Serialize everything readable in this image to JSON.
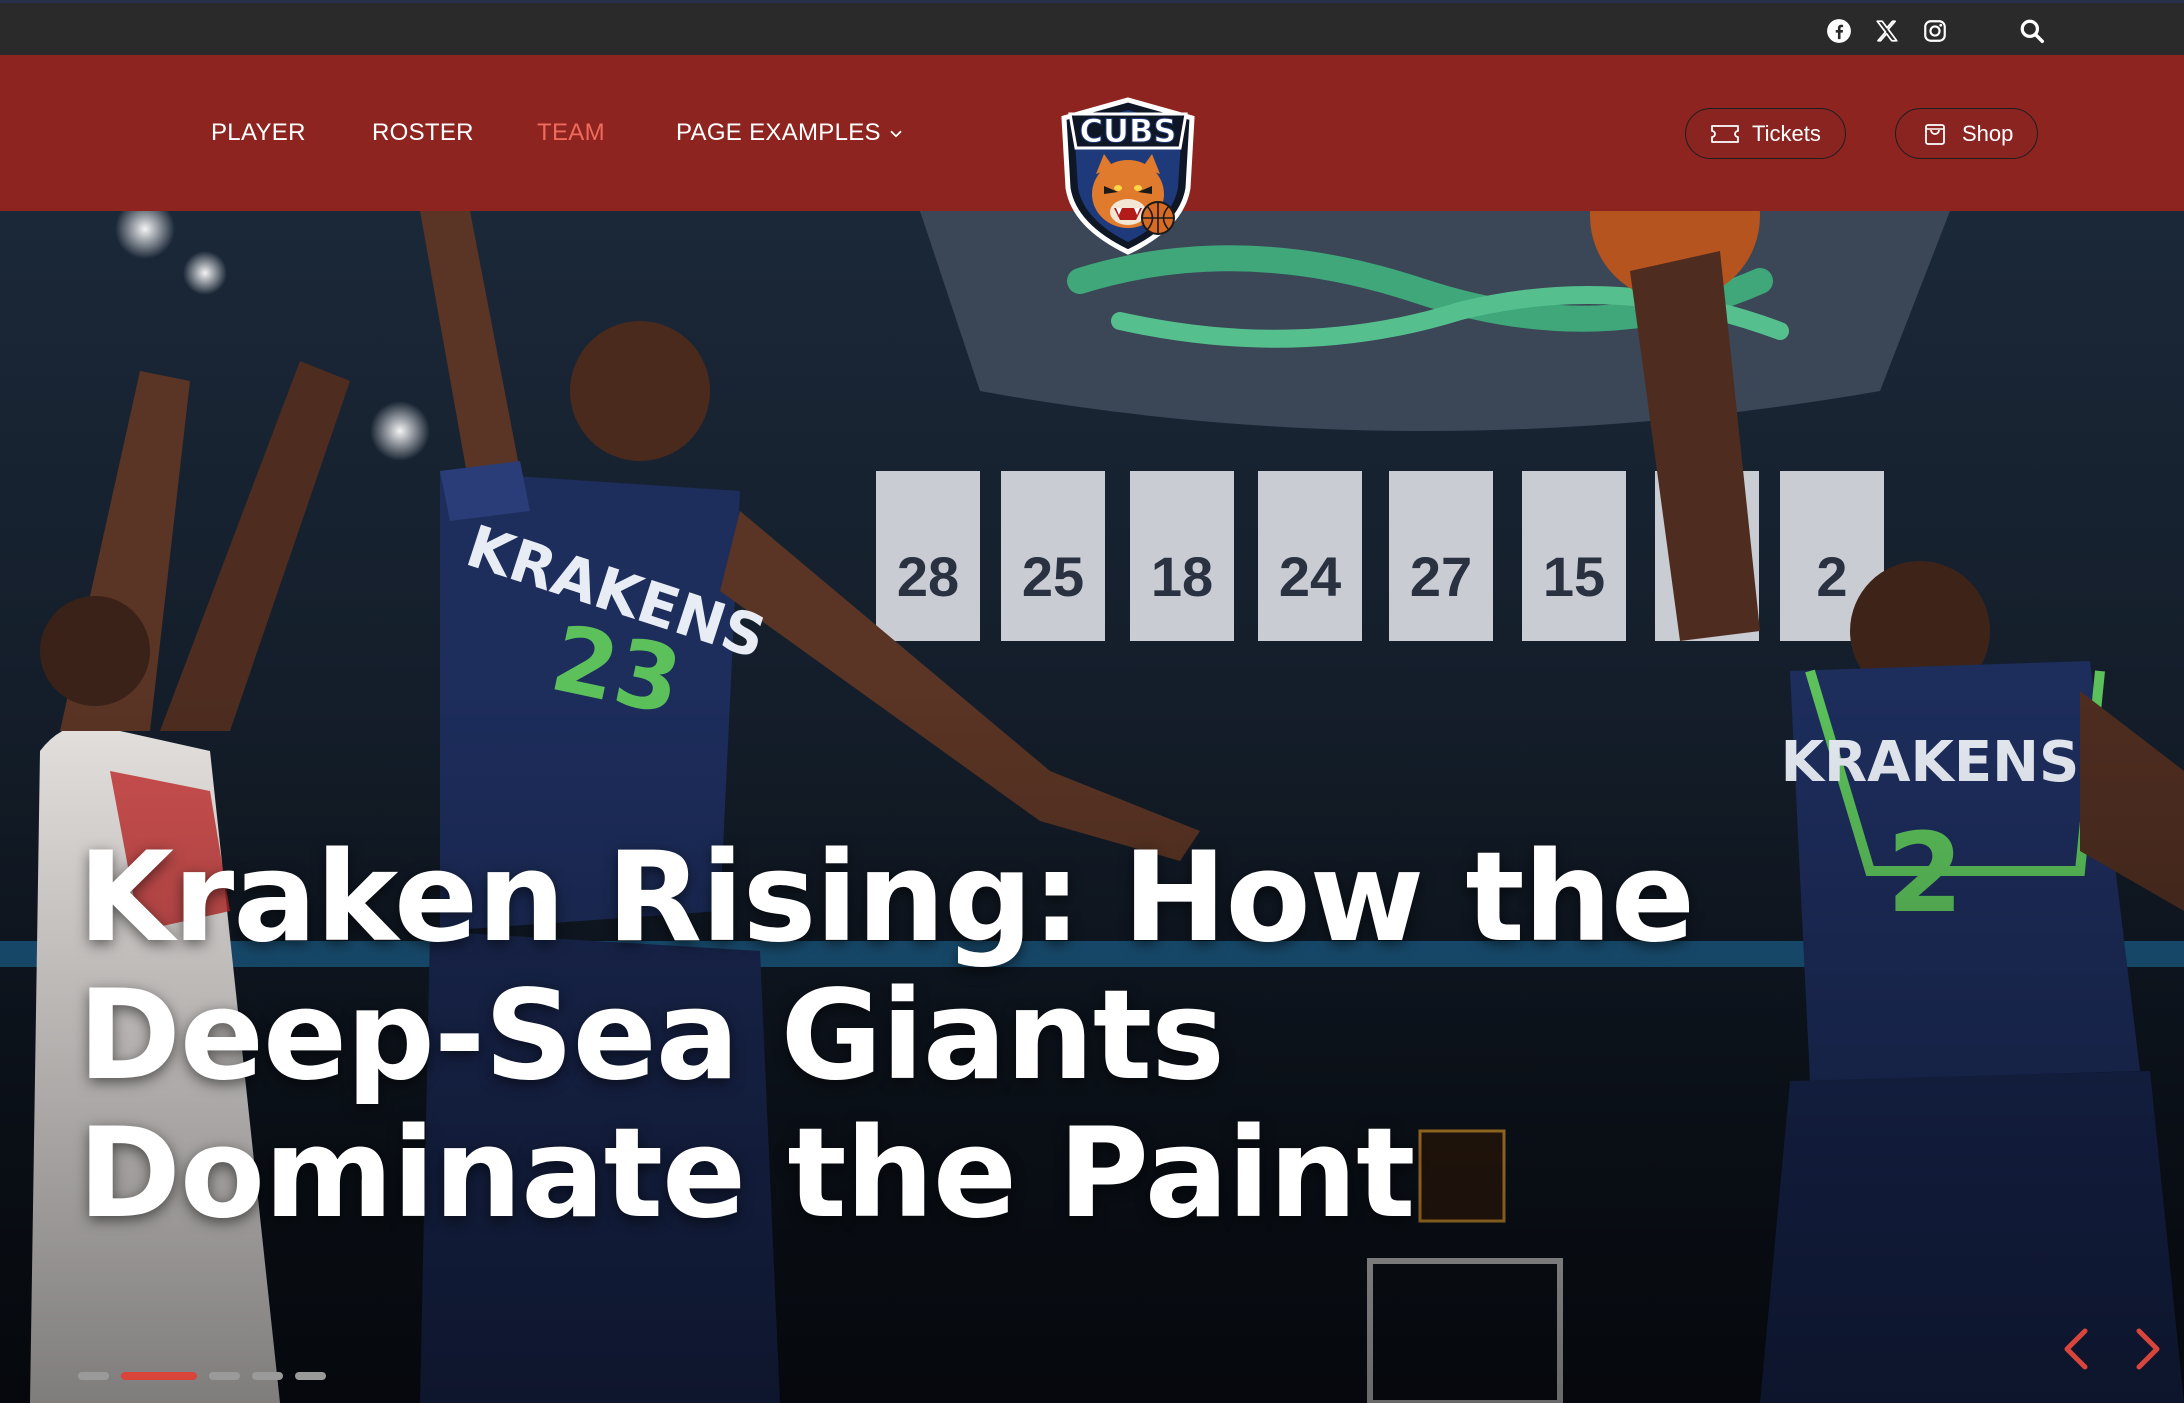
{
  "topbar": {
    "social": [
      {
        "icon": "facebook-icon"
      },
      {
        "icon": "x-twitter-icon"
      },
      {
        "icon": "instagram-icon"
      }
    ],
    "search_icon": "search-icon"
  },
  "nav": {
    "links": [
      {
        "label": "PLAYER",
        "active": false
      },
      {
        "label": "ROSTER",
        "active": false
      },
      {
        "label": "TEAM",
        "active": true
      },
      {
        "label": "PAGE EXAMPLES",
        "active": false,
        "has_dropdown": true
      }
    ],
    "logo_text": "CUBS",
    "buttons": [
      {
        "label": "Tickets",
        "icon": "ticket-icon"
      },
      {
        "label": "Shop",
        "icon": "shopping-bag-icon"
      }
    ]
  },
  "hero": {
    "headline": "Kraken Rising: How the Deep-Sea Giants Dominate the Paint",
    "slides_total": 5,
    "active_slide": 2,
    "prev_icon": "chevron-left-icon",
    "next_icon": "chevron-right-icon"
  },
  "colors": {
    "topbar": "#2b2a2b",
    "nav": "#8d2420",
    "active_link": "#ef6a5c",
    "accent": "#d9443b"
  }
}
